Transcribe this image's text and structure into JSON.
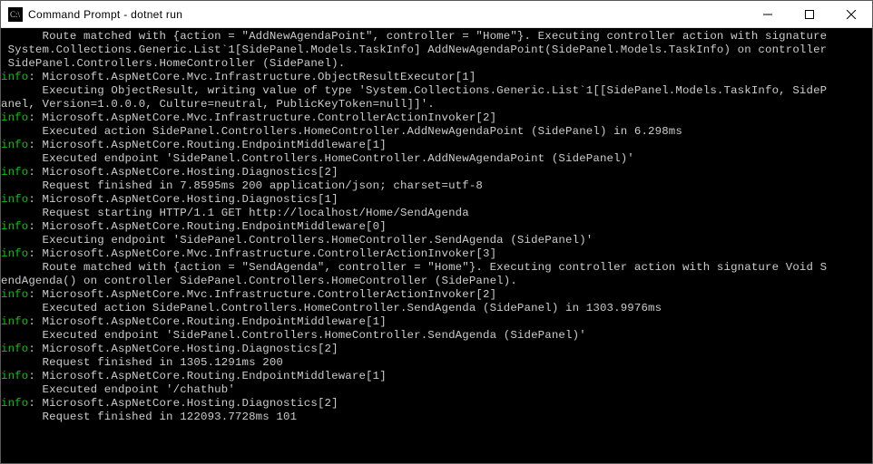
{
  "window": {
    "title": "Command Prompt - dotnet  run"
  },
  "colors": {
    "info": "#10c010",
    "text": "#cccccc",
    "bg": "#000000"
  },
  "lines": [
    {
      "prefix": "",
      "indent": "      ",
      "text": "Route matched with {action = \"AddNewAgendaPoint\", controller = \"Home\"}. Executing controller action with signature"
    },
    {
      "prefix": "",
      "indent": " ",
      "text": "System.Collections.Generic.List`1[SidePanel.Models.TaskInfo] AddNewAgendaPoint(SidePanel.Models.TaskInfo) on controller"
    },
    {
      "prefix": "",
      "indent": " ",
      "text": "SidePanel.Controllers.HomeController (SidePanel)."
    },
    {
      "prefix": "info",
      "indent": "",
      "text": ": Microsoft.AspNetCore.Mvc.Infrastructure.ObjectResultExecutor[1]"
    },
    {
      "prefix": "",
      "indent": "      ",
      "text": "Executing ObjectResult, writing value of type 'System.Collections.Generic.List`1[[SidePanel.Models.TaskInfo, SideP"
    },
    {
      "prefix": "",
      "indent": "",
      "text": "anel, Version=1.0.0.0, Culture=neutral, PublicKeyToken=null]]'."
    },
    {
      "prefix": "info",
      "indent": "",
      "text": ": Microsoft.AspNetCore.Mvc.Infrastructure.ControllerActionInvoker[2]"
    },
    {
      "prefix": "",
      "indent": "      ",
      "text": "Executed action SidePanel.Controllers.HomeController.AddNewAgendaPoint (SidePanel) in 6.298ms"
    },
    {
      "prefix": "info",
      "indent": "",
      "text": ": Microsoft.AspNetCore.Routing.EndpointMiddleware[1]"
    },
    {
      "prefix": "",
      "indent": "      ",
      "text": "Executed endpoint 'SidePanel.Controllers.HomeController.AddNewAgendaPoint (SidePanel)'"
    },
    {
      "prefix": "info",
      "indent": "",
      "text": ": Microsoft.AspNetCore.Hosting.Diagnostics[2]"
    },
    {
      "prefix": "",
      "indent": "      ",
      "text": "Request finished in 7.8595ms 200 application/json; charset=utf-8"
    },
    {
      "prefix": "info",
      "indent": "",
      "text": ": Microsoft.AspNetCore.Hosting.Diagnostics[1]"
    },
    {
      "prefix": "",
      "indent": "      ",
      "text": "Request starting HTTP/1.1 GET http://localhost/Home/SendAgenda"
    },
    {
      "prefix": "info",
      "indent": "",
      "text": ": Microsoft.AspNetCore.Routing.EndpointMiddleware[0]"
    },
    {
      "prefix": "",
      "indent": "      ",
      "text": "Executing endpoint 'SidePanel.Controllers.HomeController.SendAgenda (SidePanel)'"
    },
    {
      "prefix": "info",
      "indent": "",
      "text": ": Microsoft.AspNetCore.Mvc.Infrastructure.ControllerActionInvoker[3]"
    },
    {
      "prefix": "",
      "indent": "      ",
      "text": "Route matched with {action = \"SendAgenda\", controller = \"Home\"}. Executing controller action with signature Void S"
    },
    {
      "prefix": "",
      "indent": "",
      "text": "endAgenda() on controller SidePanel.Controllers.HomeController (SidePanel)."
    },
    {
      "prefix": "info",
      "indent": "",
      "text": ": Microsoft.AspNetCore.Mvc.Infrastructure.ControllerActionInvoker[2]"
    },
    {
      "prefix": "",
      "indent": "      ",
      "text": "Executed action SidePanel.Controllers.HomeController.SendAgenda (SidePanel) in 1303.9976ms"
    },
    {
      "prefix": "info",
      "indent": "",
      "text": ": Microsoft.AspNetCore.Routing.EndpointMiddleware[1]"
    },
    {
      "prefix": "",
      "indent": "      ",
      "text": "Executed endpoint 'SidePanel.Controllers.HomeController.SendAgenda (SidePanel)'"
    },
    {
      "prefix": "info",
      "indent": "",
      "text": ": Microsoft.AspNetCore.Hosting.Diagnostics[2]"
    },
    {
      "prefix": "",
      "indent": "      ",
      "text": "Request finished in 1305.1291ms 200"
    },
    {
      "prefix": "info",
      "indent": "",
      "text": ": Microsoft.AspNetCore.Routing.EndpointMiddleware[1]"
    },
    {
      "prefix": "",
      "indent": "      ",
      "text": "Executed endpoint '/chathub'"
    },
    {
      "prefix": "info",
      "indent": "",
      "text": ": Microsoft.AspNetCore.Hosting.Diagnostics[2]"
    },
    {
      "prefix": "",
      "indent": "      ",
      "text": "Request finished in 122093.7728ms 101"
    }
  ]
}
